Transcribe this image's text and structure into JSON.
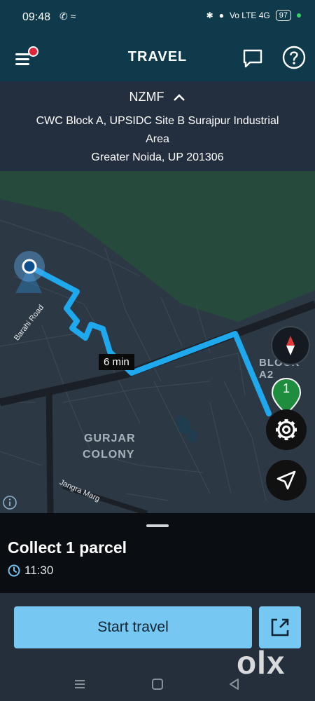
{
  "status_bar": {
    "time": "09:48",
    "network": "Vo LTE 4G",
    "battery": "97"
  },
  "app_bar": {
    "title": "TRAVEL",
    "menu_icon": "hamburger-menu-icon",
    "chat_icon": "chat-bubble-icon",
    "help_icon": "help-circle-icon"
  },
  "address": {
    "code": "NZMF",
    "line1": "CWC Block A, UPSIDC Site B Surajpur Industrial",
    "line2": "Area",
    "line3": "Greater Noida, UP 201306"
  },
  "map": {
    "eta": "6 min",
    "area_label_1": "GURJAR",
    "area_label_2": "COLONY",
    "block_label": "BLOCK A2",
    "street_1": "Barahi Road",
    "street_2": "Jangra Marg",
    "stop_number": "1",
    "route_color": "#1ea9ef",
    "stop_color": "#1e8e3e"
  },
  "task": {
    "title": "Collect 1 parcel",
    "time": "11:30"
  },
  "actions": {
    "start_label": "Start travel",
    "external_icon": "open-external-icon",
    "watermark": "olx"
  }
}
